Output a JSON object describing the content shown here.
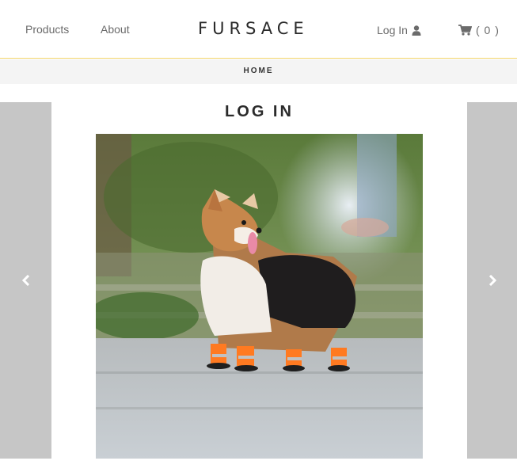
{
  "header": {
    "nav": [
      {
        "label": "Products"
      },
      {
        "label": "About"
      }
    ],
    "logo": "FURSACE",
    "login_label": "Log In",
    "cart_label": "( 0 )"
  },
  "breadcrumb": "HOME",
  "main": {
    "title": "LOG IN"
  },
  "icons": {
    "user": "user-icon",
    "cart": "shopping-cart-icon",
    "prev": "chevron-left-icon",
    "next": "chevron-right-icon"
  },
  "colors": {
    "header_border": "#f2d46a",
    "breadcrumb_bg": "#f4f4f4",
    "slider_button": "#c6c6c6"
  }
}
